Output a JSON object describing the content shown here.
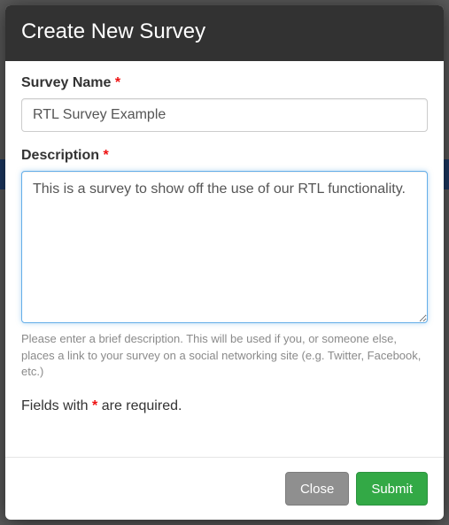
{
  "modal": {
    "title": "Create New Survey"
  },
  "form": {
    "survey_name": {
      "label": "Survey Name",
      "required_marker": "*",
      "value": "RTL Survey Example"
    },
    "description": {
      "label": "Description",
      "required_marker": "*",
      "value": "This is a survey to show off the use of our RTL functionality.",
      "help": "Please enter a brief description. This will be used if you, or someone else, places a link to your survey on a social networking site (e.g. Twitter, Facebook, etc.)"
    },
    "required_note_prefix": "Fields with ",
    "required_note_marker": "*",
    "required_note_suffix": " are required."
  },
  "footer": {
    "close_label": "Close",
    "submit_label": "Submit"
  }
}
